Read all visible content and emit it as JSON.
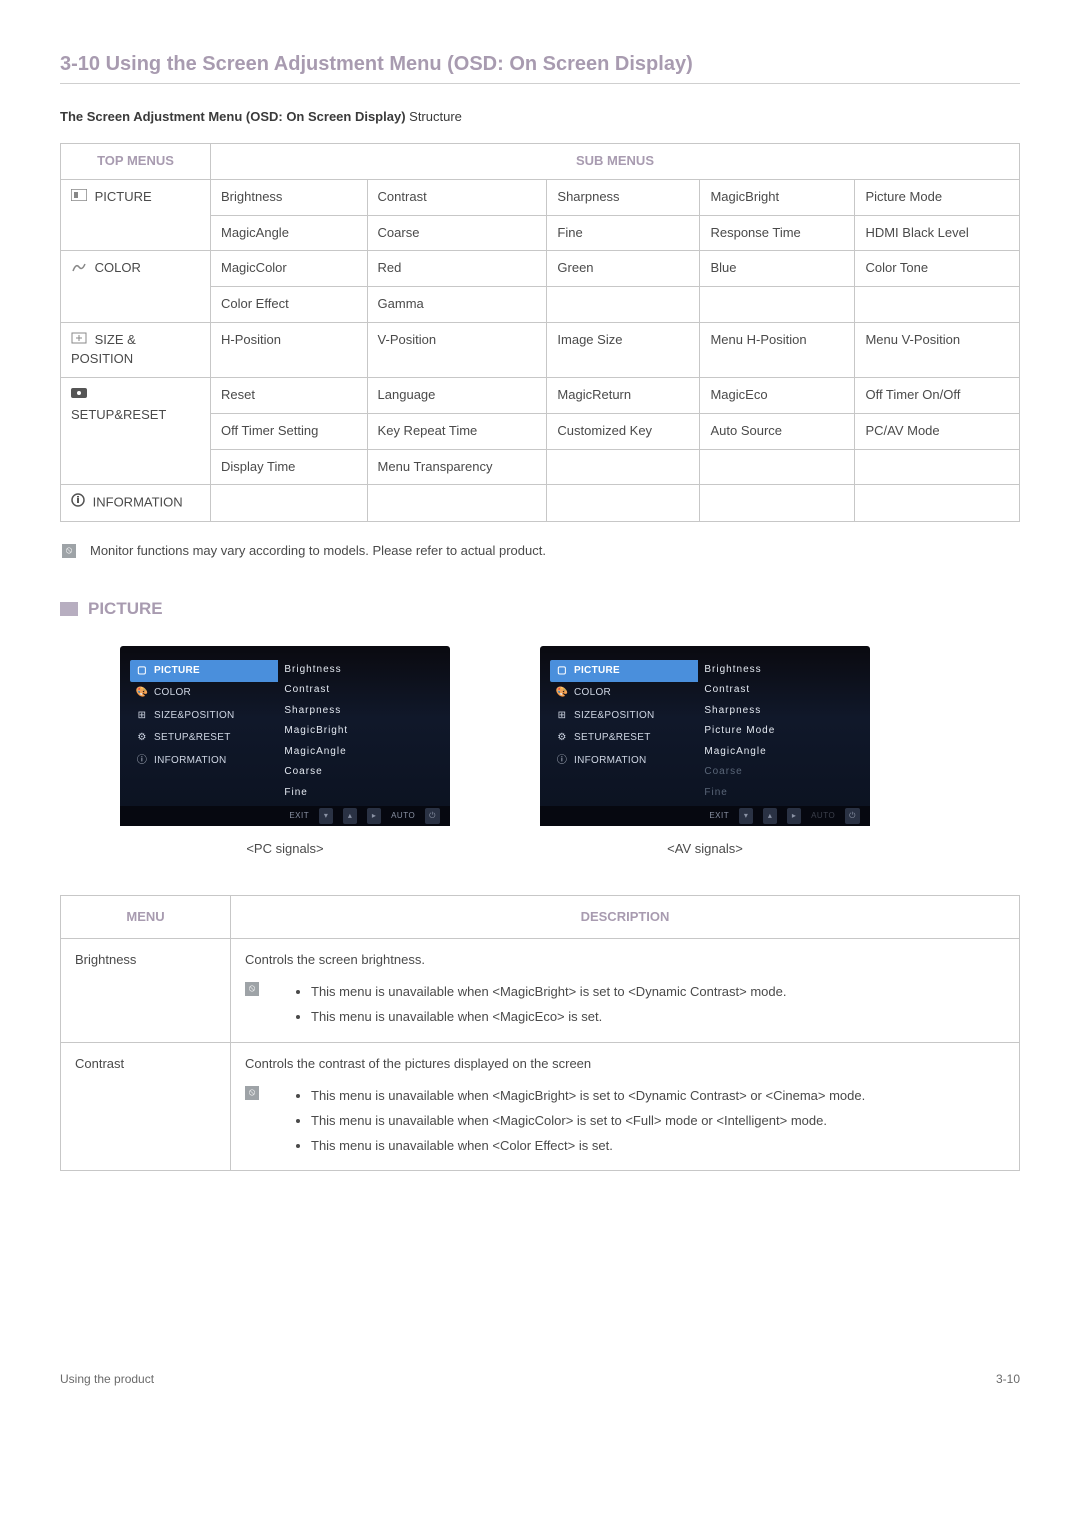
{
  "title": "3-10  Using the Screen Adjustment Menu (OSD: On Screen Display)",
  "subheading_bold": "The Screen Adjustment Menu (OSD: On Screen Display)",
  "subheading_light": " Structure",
  "table1": {
    "h_top": "TOP MENUS",
    "h_sub": "SUB MENUS",
    "rows": [
      {
        "top": "PICTURE",
        "icon": "picture-icon",
        "cells": [
          [
            "Brightness",
            "Contrast",
            "Sharpness",
            "MagicBright",
            "Picture Mode"
          ],
          [
            "MagicAngle",
            "Coarse",
            "Fine",
            "Response Time",
            "HDMI Black Level"
          ]
        ]
      },
      {
        "top": "COLOR",
        "icon": "color-icon",
        "cells": [
          [
            "MagicColor",
            "Red",
            "Green",
            "Blue",
            "Color Tone"
          ],
          [
            "Color Effect",
            "Gamma",
            "",
            "",
            ""
          ]
        ]
      },
      {
        "top": "SIZE & POSITION",
        "icon": "sizepos-icon",
        "cells": [
          [
            "H-Position",
            "V-Position",
            "Image Size",
            "Menu H-Position",
            "Menu V-Position"
          ]
        ]
      },
      {
        "top": "SETUP&RESET",
        "icon": "setup-icon",
        "cells": [
          [
            "Reset",
            "Language",
            "MagicReturn",
            "MagicEco",
            "Off Timer On/Off"
          ],
          [
            "Off Timer Setting",
            "Key Repeat Time",
            "Customized Key",
            "Auto Source",
            "PC/AV Mode"
          ],
          [
            "Display Time",
            "Menu Transparency",
            "",
            "",
            ""
          ]
        ]
      },
      {
        "top": "INFORMATION",
        "icon": "info-icon",
        "cells": [
          [
            "",
            "",
            "",
            "",
            ""
          ]
        ]
      }
    ]
  },
  "note1": "Monitor functions may vary according to models. Please refer to actual product.",
  "picture_hdr": "PICTURE",
  "osd": {
    "menu": [
      "PICTURE",
      "COLOR",
      "SIZE&POSITION",
      "SETUP&RESET",
      "INFORMATION"
    ],
    "subs_pc": [
      "Brightness",
      "Contrast",
      "Sharpness",
      "MagicBright",
      "MagicAngle",
      "Coarse",
      "Fine"
    ],
    "subs_av": [
      {
        "t": "Brightness",
        "dim": false
      },
      {
        "t": "Contrast",
        "dim": false
      },
      {
        "t": "Sharpness",
        "dim": false
      },
      {
        "t": "Picture Mode",
        "dim": false
      },
      {
        "t": "MagicAngle",
        "dim": false
      },
      {
        "t": "Coarse",
        "dim": true
      },
      {
        "t": "Fine",
        "dim": true
      }
    ],
    "footer": [
      "EXIT",
      "",
      "",
      "",
      "AUTO",
      ""
    ],
    "caption_pc": "<PC signals>",
    "caption_av": "<AV signals>"
  },
  "table2": {
    "h_menu": "MENU",
    "h_desc": "DESCRIPTION",
    "rows": [
      {
        "name": "Brightness",
        "lead": "Controls the screen brightness.",
        "bullets": [
          "This menu is unavailable when <MagicBright> is set to <Dynamic Contrast> mode.",
          "This menu is unavailable when <MagicEco> is set."
        ]
      },
      {
        "name": "Contrast",
        "lead": "Controls the contrast of the pictures displayed on the screen",
        "bullets": [
          "This menu is unavailable when <MagicBright> is set to <Dynamic Contrast> or <Cinema> mode.",
          "This menu is unavailable when <MagicColor> is set to <Full> mode or <Intelligent> mode.",
          "This menu is unavailable when <Color Effect> is set."
        ]
      }
    ]
  },
  "footer_left": "Using the product",
  "footer_right": "3-10"
}
